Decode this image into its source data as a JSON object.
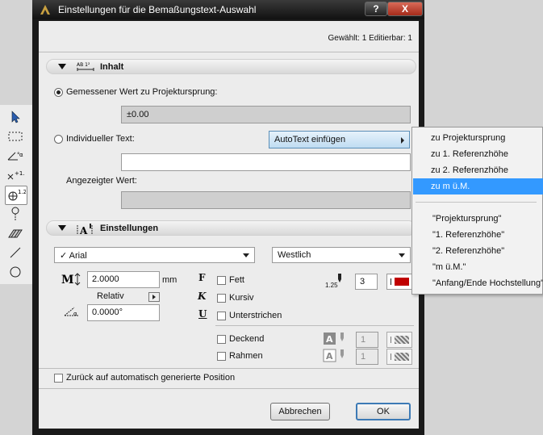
{
  "window": {
    "title": "Einstellungen für die Bemaßungstext-Auswahl",
    "help_label": "?",
    "close_label": "X"
  },
  "selection_info": "Gewählt: 1 Editierbar: 1",
  "inhalt": {
    "header": "Inhalt",
    "icon_label": "AB 1²",
    "radio_measured": "Gemessener Wert zu Projektursprung:",
    "measured_value": "±0.00",
    "radio_custom": "Individueller Text:",
    "autotext_button": "AutoText einfügen",
    "custom_text_value": "",
    "displayed_label": "Angezeigter Wert:",
    "displayed_value": ""
  },
  "einstellungen": {
    "header": "Einstellungen",
    "font": "✓ Arial",
    "encoding": "Westlich",
    "size_value": "2.0000",
    "size_unit": "mm",
    "relative_label": "Relativ",
    "angle_value": "0.0000°",
    "bold": "Fett",
    "italic": "Kursiv",
    "underline": "Unterstrichen",
    "pen_label": "1.25",
    "pen_value": "3",
    "opaque": "Deckend",
    "frame": "Rahmen",
    "opaque_value": "1",
    "frame_value": "1"
  },
  "reset_label": "Zurück auf automatisch generierte Position",
  "buttons": {
    "cancel": "Abbrechen",
    "ok": "OK"
  },
  "menu": {
    "items": [
      "zu Projektursprung",
      "zu 1. Referenzhöhe",
      "zu 2. Referenzhöhe",
      "zu m ü.M."
    ],
    "items2": [
      "\"Projektursprung\"",
      "\"1. Referenzhöhe\"",
      "\"2. Referenzhöhe\"",
      "\"m ü.M.\"",
      "\"Anfang/Ende Hochstellung\""
    ]
  },
  "colors": {
    "accent": "#3399ff",
    "pen": "#c00000"
  }
}
